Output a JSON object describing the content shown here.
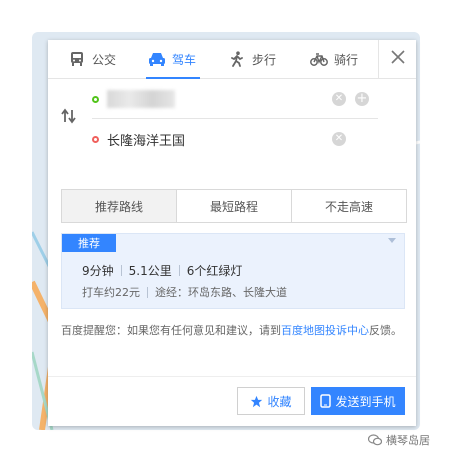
{
  "tabs": [
    {
      "label": "公交",
      "icon": "bus-icon",
      "active": false
    },
    {
      "label": "驾车",
      "icon": "car-icon",
      "active": true
    },
    {
      "label": "步行",
      "icon": "walk-icon",
      "active": false
    },
    {
      "label": "骑行",
      "icon": "bike-icon",
      "active": false
    }
  ],
  "route": {
    "start_value": "",
    "end_value": "长隆海洋王国"
  },
  "filters": [
    "推荐路线",
    "最短路程",
    "不走高速"
  ],
  "result": {
    "badge": "推荐",
    "duration": "9分钟",
    "distance": "5.1公里",
    "lights": "6个红绿灯",
    "taxi": "打车约22元",
    "via": "途经：环岛东路、长隆大道"
  },
  "notice": {
    "prefix": "百度提醒您：如果您有任何意见和建议，请到",
    "link": "百度地图投诉中心",
    "suffix": "反馈。"
  },
  "actions": {
    "favorite": "收藏",
    "send": "发送到手机"
  },
  "watermark": "横琴岛居",
  "colors": {
    "accent": "#3385ff",
    "start_dot": "#52c41a",
    "end_dot": "#f0605c",
    "result_bg": "#ebf2fd"
  }
}
